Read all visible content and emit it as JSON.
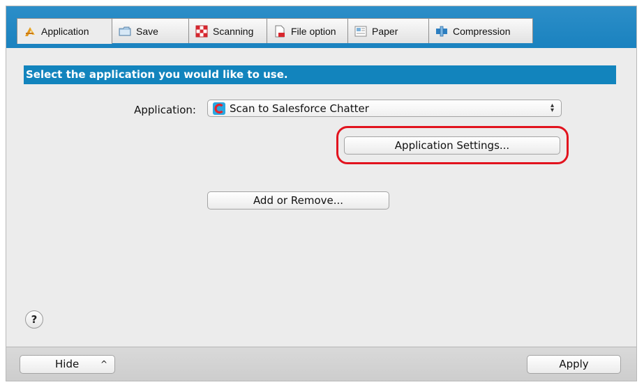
{
  "tabs": [
    {
      "label": "Application",
      "icon": "application-icon",
      "active": true
    },
    {
      "label": "Save",
      "icon": "folder-icon",
      "active": false
    },
    {
      "label": "Scanning",
      "icon": "scanning-icon",
      "active": false
    },
    {
      "label": "File option",
      "icon": "file-icon",
      "active": false
    },
    {
      "label": "Paper",
      "icon": "paper-icon",
      "active": false
    },
    {
      "label": "Compression",
      "icon": "compression-icon",
      "active": false
    }
  ],
  "main": {
    "banner": "Select the application you would like to use.",
    "application_label": "Application:",
    "application_value": "Scan to Salesforce Chatter",
    "application_icon": "salesforce-chatter-icon",
    "settings_button": "Application Settings...",
    "add_remove_button": "Add or Remove...",
    "help_label": "?"
  },
  "footer": {
    "hide_button": "Hide",
    "hide_caret": "^",
    "apply_button": "Apply"
  },
  "colors": {
    "accent": "#1284bd",
    "tabbar": "#1a82bf",
    "highlight": "#e2131e"
  }
}
